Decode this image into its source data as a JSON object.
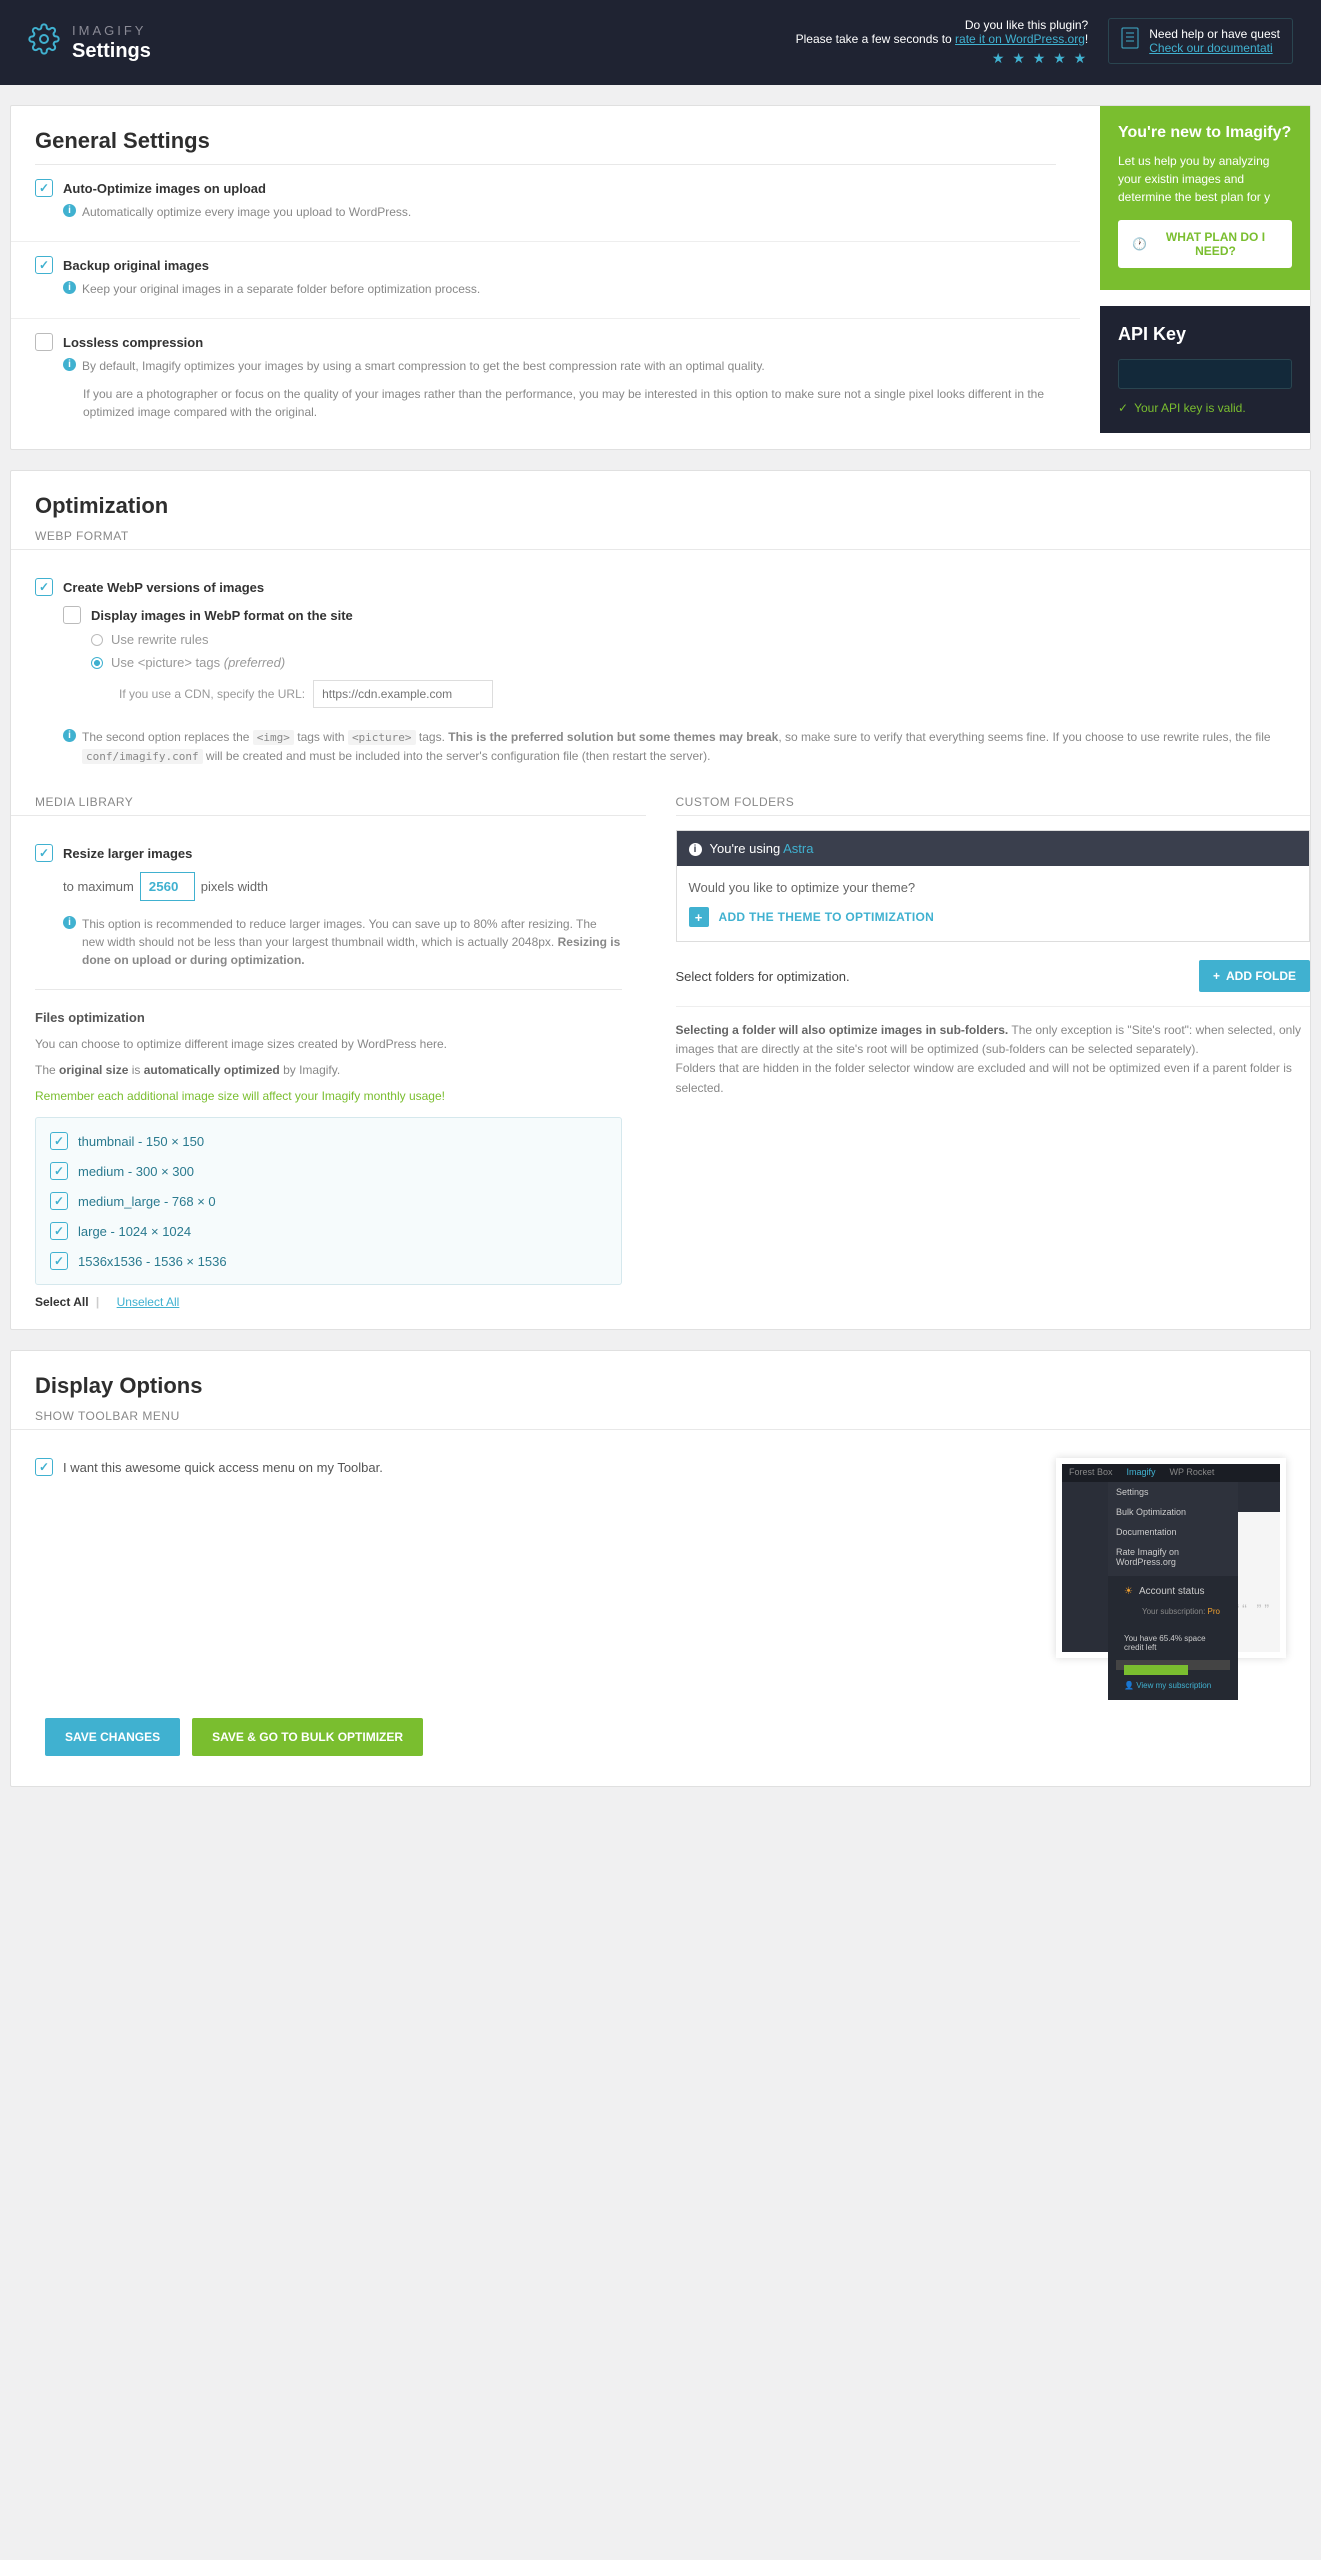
{
  "header": {
    "logo": "IMAGIFY",
    "title": "Settings",
    "rate_q": "Do you like this plugin?",
    "rate_pre": "Please take a few seconds to ",
    "rate_link": "rate it on WordPress.org",
    "help_q": "Need help or have quest",
    "help_link": "Check our documentati"
  },
  "general": {
    "title": "General Settings",
    "auto": {
      "label": "Auto-Optimize images on upload",
      "desc": "Automatically optimize every image you upload to WordPress."
    },
    "backup": {
      "label": "Backup original images",
      "desc": "Keep your original images in a separate folder before optimization process."
    },
    "lossless": {
      "label": "Lossless compression",
      "desc": "By default, Imagify optimizes your images by using a smart compression to get the best compression rate with an optimal quality.",
      "extra": "If you are a photographer or focus on the quality of your images rather than the performance, you may be interested in this option to make sure not a single pixel looks different in the optimized image compared with the original."
    }
  },
  "sidebar": {
    "new_title": "You're new to Imagify?",
    "new_text": "Let us help you by analyzing your existin images and determine the best plan for y",
    "plan_btn": "WHAT PLAN DO I NEED?",
    "api_title": "API Key",
    "api_valid": "Your API key is valid."
  },
  "optimization": {
    "title": "Optimization",
    "webp_section": "WEBP FORMAT",
    "webp_create": "Create WebP versions of images",
    "webp_display": "Display images in WebP format on the site",
    "rewrite": "Use rewrite rules",
    "picture": "Use <picture> tags ",
    "picture_pref": "(preferred)",
    "cdn_label": "If you use a CDN, specify the URL:",
    "cdn_placeholder": "https://cdn.example.com",
    "webp_note_1": "The second option replaces the ",
    "webp_note_2": " tags with ",
    "webp_note_3": " tags. ",
    "webp_note_bold": "This is the preferred solution but some themes may break",
    "webp_note_4": ", so make sure to verify that everything seems fine. If you choose to use rewrite rules, the file ",
    "webp_note_5": " will be created and must be included into the server's configuration file (then restart the server).",
    "code_img": "<img>",
    "code_pic": "<picture>",
    "code_conf": "conf/imagify.conf",
    "media_section": "MEDIA LIBRARY",
    "resize_label": "Resize larger images",
    "resize_to": "to maximum",
    "resize_val": "2560",
    "resize_px": "pixels width",
    "resize_desc_1": "This option is recommended to reduce larger images. You can save up to 80% after resizing. The new width should not be less than your largest thumbnail width, which is actually 2048px. ",
    "resize_desc_bold": "Resizing is done on upload or during optimization.",
    "custom_section": "CUSTOM FOLDERS",
    "using": "You're using ",
    "theme": "Astra",
    "theme_q": "Would you like to optimize your theme?",
    "add_theme": "ADD THE THEME TO OPTIMIZATION",
    "select_folders": "Select folders for optimization.",
    "add_folder": "ADD FOLDE",
    "folder_desc_bold": "Selecting a folder will also optimize images in sub-folders.",
    "folder_desc_1": " The only exception is \"Site's root\": when selected, only images that are directly at the site's root will be optimized (sub-folders can be selected separately).",
    "folder_desc_2": "Folders that are hidden in the folder selector window are excluded and will not be optimized even if a parent folder is selected.",
    "files_title": "Files optimization",
    "files_p1": "You can choose to optimize different image sizes created by WordPress here.",
    "files_p2a": "The ",
    "files_p2b": "original size",
    "files_p2c": " is ",
    "files_p2d": "automatically optimized",
    "files_p2e": " by Imagify.",
    "files_warn": "Remember each additional image size will affect your Imagify monthly usage!",
    "sizes": [
      "thumbnail - 150 × 150",
      "medium - 300 × 300",
      "medium_large - 768 × 0",
      "large - 1024 × 1024",
      "1536x1536 - 1536 × 1536"
    ],
    "select_all": "Select All",
    "unselect_all": "Unselect All"
  },
  "display": {
    "title": "Display Options",
    "section": "SHOW TOOLBAR MENU",
    "label": "I want this awesome quick access menu on my Toolbar.",
    "tabs": [
      "Forest Box",
      "Imagify",
      "WP Rocket"
    ],
    "menu": [
      "Settings",
      "Bulk Optimization",
      "Documentation",
      "Rate Imagify on WordPress.org"
    ],
    "acct_title": "Account status",
    "acct_sub": "Your subscription: ",
    "acct_plan": "Pro",
    "credit": "You have 65.4% space credit left",
    "view_sub": "View my subscription"
  },
  "footer": {
    "save": "SAVE CHANGES",
    "save_go": "SAVE & GO TO BULK OPTIMIZER"
  }
}
